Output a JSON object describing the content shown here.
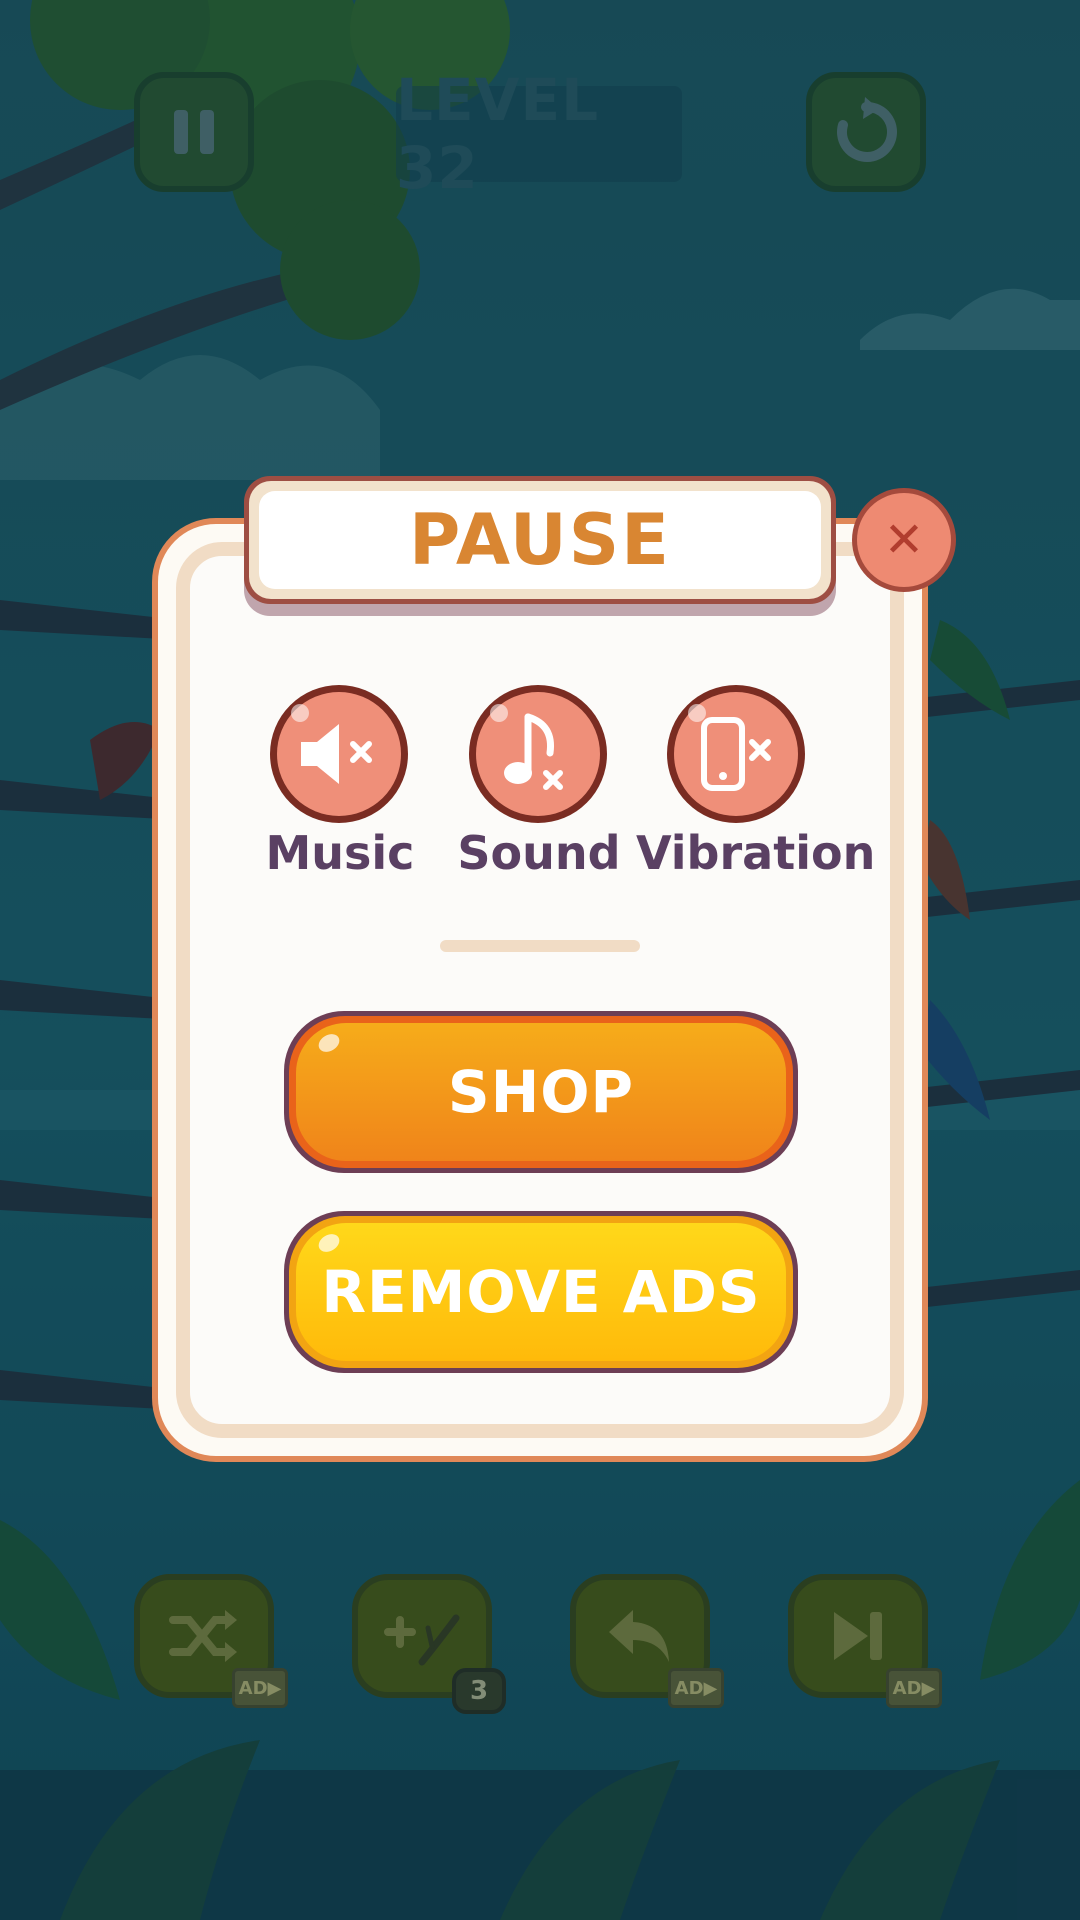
{
  "hud": {
    "level_text": "LEVEL 32",
    "pause_icon": "pause-icon",
    "restart_icon": "restart-icon"
  },
  "tools": [
    {
      "icon": "shuffle-icon",
      "tag": "AD▶"
    },
    {
      "icon": "add-branch-icon",
      "count": "3"
    },
    {
      "icon": "undo-icon",
      "tag": "AD▶"
    },
    {
      "icon": "skip-icon",
      "tag": "AD▶"
    }
  ],
  "dialog": {
    "title": "PAUSE",
    "close_icon": "close-icon",
    "toggles": [
      {
        "label": "Music",
        "icon": "music-muted-icon",
        "state": "off"
      },
      {
        "label": "Sound",
        "icon": "sound-muted-icon",
        "state": "off"
      },
      {
        "label": "Vibration",
        "icon": "vibration-off-icon",
        "state": "off"
      }
    ],
    "shop_label": "SHOP",
    "remove_ads_label": "REMOVE ADS"
  },
  "colors": {
    "accent_orange": "#f0841a",
    "accent_yellow": "#ffba0a",
    "toggle_red": "#ef8f79",
    "title_orange": "#d98632",
    "label_purple": "#5a4063"
  }
}
